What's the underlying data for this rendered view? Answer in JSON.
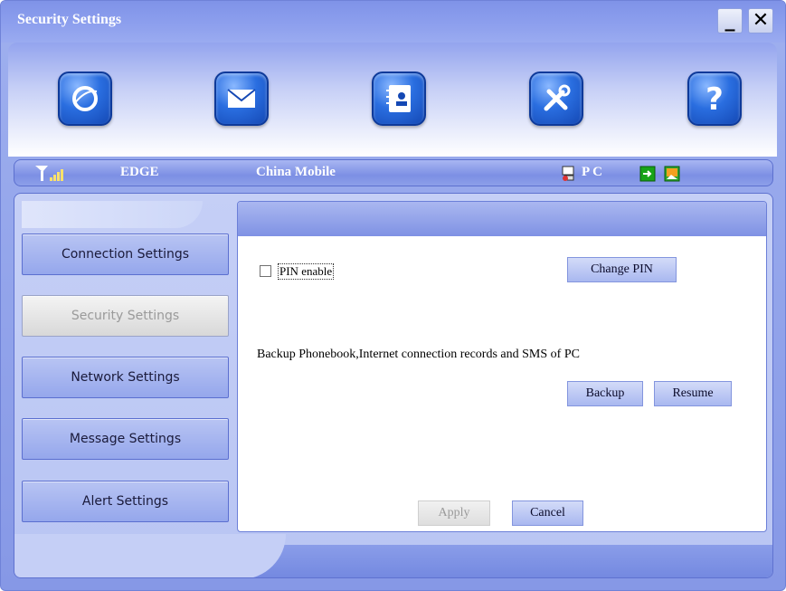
{
  "window": {
    "title": "Security Settings",
    "minimize_label": "_",
    "close_label": "✕"
  },
  "toolbar": {
    "items": [
      {
        "name": "internet-icon"
      },
      {
        "name": "sms-icon"
      },
      {
        "name": "phonebook-icon"
      },
      {
        "name": "settings-icon"
      },
      {
        "name": "help-icon"
      }
    ]
  },
  "status": {
    "network": "EDGE",
    "operator": "China Mobile",
    "storage": "P C",
    "signal_icon": "signal-icon"
  },
  "nav": {
    "items": [
      {
        "label": "Connection Settings",
        "active": false
      },
      {
        "label": "Security Settings",
        "active": true
      },
      {
        "label": "Network Settings",
        "active": false
      },
      {
        "label": "Message Settings",
        "active": false
      },
      {
        "label": "Alert Settings",
        "active": false
      }
    ]
  },
  "security": {
    "pin_enable_label": "PIN enable",
    "pin_enabled": false,
    "change_pin_label": "Change PIN",
    "backup_description": "Backup Phonebook,Internet connection records and SMS of PC",
    "backup_label": "Backup",
    "resume_label": "Resume",
    "apply_label": "Apply",
    "cancel_label": "Cancel"
  },
  "colors": {
    "accent": "#2a6ee0",
    "frame": "#8698e6"
  }
}
